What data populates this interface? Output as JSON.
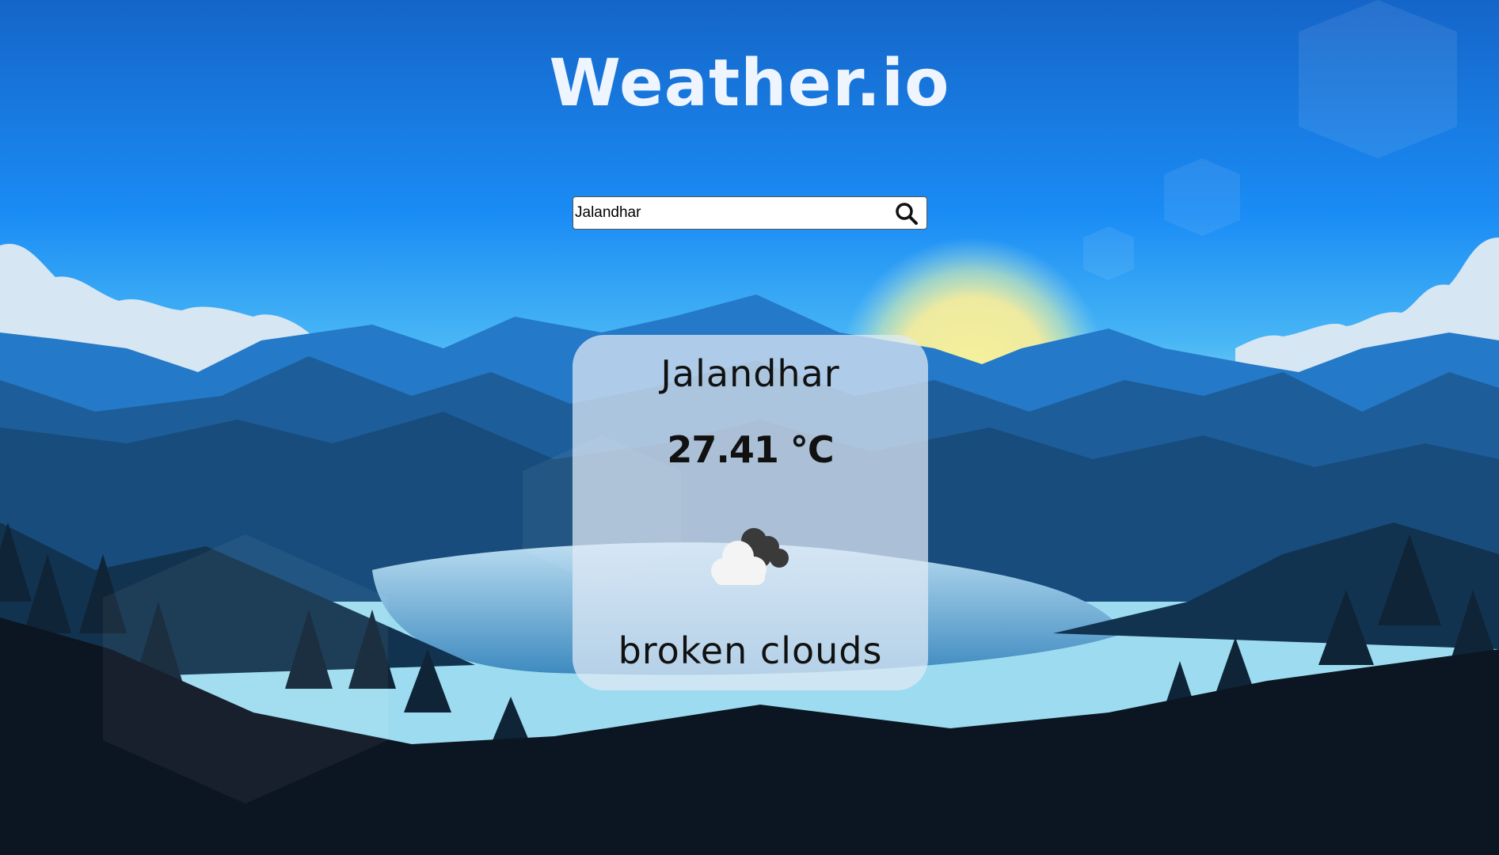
{
  "app": {
    "title": "Weather.io"
  },
  "search": {
    "value": "Jalandhar",
    "placeholder": ""
  },
  "weather": {
    "city": "Jalandhar",
    "temperature": "27.41 °C",
    "description": "broken clouds",
    "icon": "broken-clouds-icon"
  },
  "colors": {
    "sky_top": "#1565c8",
    "sky_mid": "#1e9bff",
    "horizon": "#86d4f0",
    "sun": "#f3ee9a",
    "card": "#dceaf6"
  }
}
